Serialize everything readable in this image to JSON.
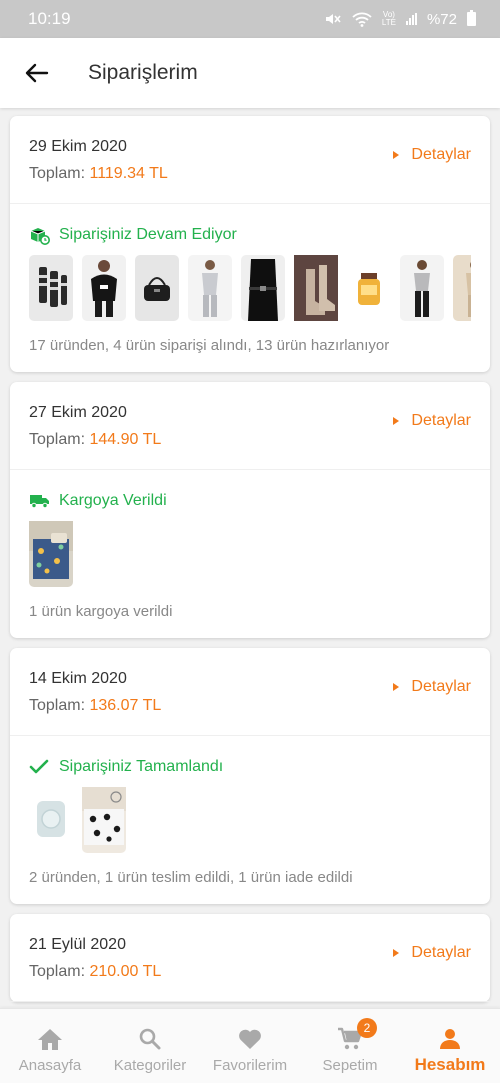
{
  "status_bar": {
    "time": "10:19",
    "battery": "%72",
    "network": "LTE",
    "volte": "Vo)"
  },
  "header": {
    "title": "Siparişlerim"
  },
  "labels": {
    "total_prefix": "Toplam:",
    "details": "Detaylar"
  },
  "colors": {
    "accent": "#f27a1a",
    "status_green": "#23b14d"
  },
  "orders": [
    {
      "date": "29 Ekim 2020",
      "total": "1119.34 TL",
      "status": "Siparişiniz Devam Ediyor",
      "status_icon": "box-clock-icon",
      "summary": "17 üründen, 4 ürün siparişi alındı, 13 ürün hazırlanıyor",
      "products": [
        "striped-socks",
        "black-sweater",
        "black-crossbody-bag",
        "grey-tracksuit",
        "black-dress-belt",
        "beige-boots",
        "perfume-bottle",
        "grey-top-black-pants",
        "beige-outfit"
      ]
    },
    {
      "date": "27 Ekim 2020",
      "total": "144.90 TL",
      "status": "Kargoya Verildi",
      "status_icon": "truck-icon",
      "summary": "1 ürün kargoya verildi",
      "products": [
        "printed-bedding"
      ]
    },
    {
      "date": "14 Ekim 2020",
      "total": "136.07 TL",
      "status": "Siparişiniz Tamamlandı",
      "status_icon": "check-icon",
      "summary": "2 üründen, 1 ürün teslim edildi, 1 ürün iade edildi",
      "products": [
        "white-towel",
        "panda-bedding"
      ]
    },
    {
      "date": "21 Eylül 2020",
      "total": "210.00 TL"
    }
  ],
  "nav": [
    {
      "label": "Anasayfa",
      "icon": "home-icon"
    },
    {
      "label": "Kategoriler",
      "icon": "search-icon"
    },
    {
      "label": "Favorilerim",
      "icon": "heart-icon"
    },
    {
      "label": "Sepetim",
      "icon": "cart-icon",
      "badge": "2"
    },
    {
      "label": "Hesabım",
      "icon": "user-icon",
      "active": true
    }
  ]
}
